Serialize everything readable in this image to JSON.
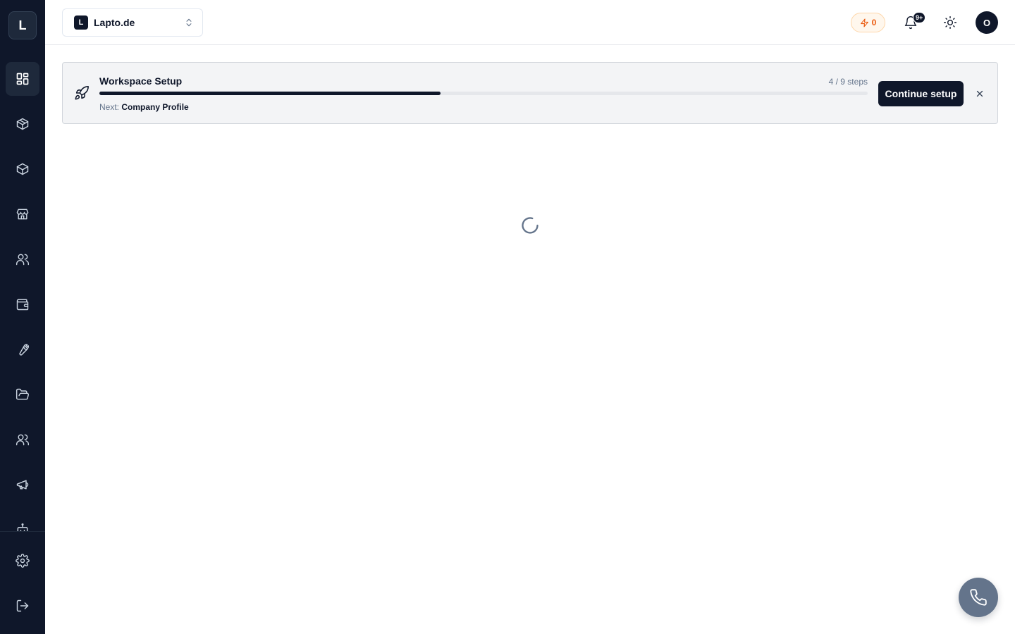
{
  "app": {
    "logo_letter": "L"
  },
  "sidebar": {
    "items": [
      {
        "icon": "dashboard-grid-icon",
        "active": true
      },
      {
        "icon": "box-icon",
        "active": false
      },
      {
        "icon": "package-icon",
        "active": false
      },
      {
        "icon": "store-icon",
        "active": false
      },
      {
        "icon": "users-icon",
        "active": false
      },
      {
        "icon": "wallet-icon",
        "active": false
      },
      {
        "icon": "wrench-icon",
        "active": false
      },
      {
        "icon": "folder-open-icon",
        "active": false
      },
      {
        "icon": "team-icon",
        "active": false
      },
      {
        "icon": "megaphone-icon",
        "active": false
      },
      {
        "icon": "bot-icon",
        "active": false
      }
    ],
    "bottom": [
      {
        "icon": "gear-icon"
      },
      {
        "icon": "logout-icon"
      }
    ]
  },
  "header": {
    "workspace_initial": "L",
    "workspace_name": "Lapto.de",
    "credits": "0",
    "notifications_badge": "9+",
    "avatar_initial": "O"
  },
  "setup": {
    "title": "Workspace Setup",
    "steps_text": "4 / 9 steps",
    "progress_fraction": 0.444,
    "next_label": "Next:",
    "next_value": "Company Profile",
    "continue_label": "Continue setup"
  },
  "colors": {
    "sidebar_bg": "#0f172a",
    "accent": "#0f172a",
    "credits_orange": "#ea580c"
  }
}
